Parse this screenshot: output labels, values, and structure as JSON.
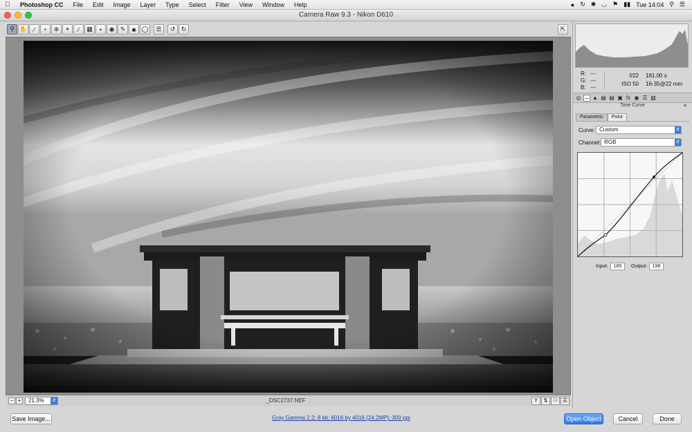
{
  "menubar": {
    "apple_icon": "apple-icon",
    "app_name": "Photoshop CC",
    "items": [
      "File",
      "Edit",
      "Image",
      "Layer",
      "Type",
      "Select",
      "Filter",
      "View",
      "Window",
      "Help"
    ],
    "clock": "Tue 14:04",
    "status_icons": [
      "creative-cloud-icon",
      "time-machine-icon",
      "bluetooth-icon",
      "wifi-icon",
      "flag-uk-icon",
      "battery-icon",
      "spotlight-search-icon",
      "notification-center-icon"
    ]
  },
  "window": {
    "title": "Camera Raw 9.3  -  Nikon D610",
    "traffic_lights": {
      "close": "#fc5f57",
      "minimize": "#fdbc2e",
      "zoom": "#33c748"
    }
  },
  "toolbar": {
    "tools": [
      "zoom-tool-icon",
      "hand-tool-icon",
      "white-balance-tool-icon",
      "color-sampler-tool-icon",
      "targeted-adjustment-tool-icon",
      "crop-tool-icon",
      "straighten-tool-icon",
      "transform-tool-icon",
      "spot-removal-tool-icon",
      "red-eye-tool-icon",
      "adjustment-brush-icon",
      "graduated-filter-icon",
      "radial-filter-icon",
      "preferences-icon",
      "rotate-ccw-icon",
      "rotate-cw-icon"
    ],
    "fullscreen_icon": "toggle-fullscreen-icon"
  },
  "preview": {
    "filename": "_DSC2737.NEF",
    "zoom": "21.3%"
  },
  "panel": {
    "readout": {
      "r_label": "R:",
      "r_value": "---",
      "g_label": "G:",
      "g_value": "---",
      "b_label": "B:",
      "b_value": "---",
      "aperture": "f/22",
      "shutter": "181.00 s",
      "iso": "ISO 50",
      "lens": "16-35@22 mm"
    },
    "section_title": "Tone Curve",
    "subtabs": [
      "Parametric",
      "Point"
    ],
    "curve_label": "Curve:",
    "curve_value": "Custom",
    "channel_label": "Channel:",
    "channel_value": "RGB",
    "input_label": "Input:",
    "input_value": "185",
    "output_label": "Output:",
    "output_value": "198"
  },
  "footer": {
    "save_label": "Save Image...",
    "workflow_link": "Gray Gamma 2.2; 8 bit; 6016 by 4016 (24.2MP); 300 ppi",
    "open_label": "Open Object",
    "cancel_label": "Cancel",
    "done_label": "Done"
  },
  "colors": {
    "accent": "#2e7ae8"
  }
}
